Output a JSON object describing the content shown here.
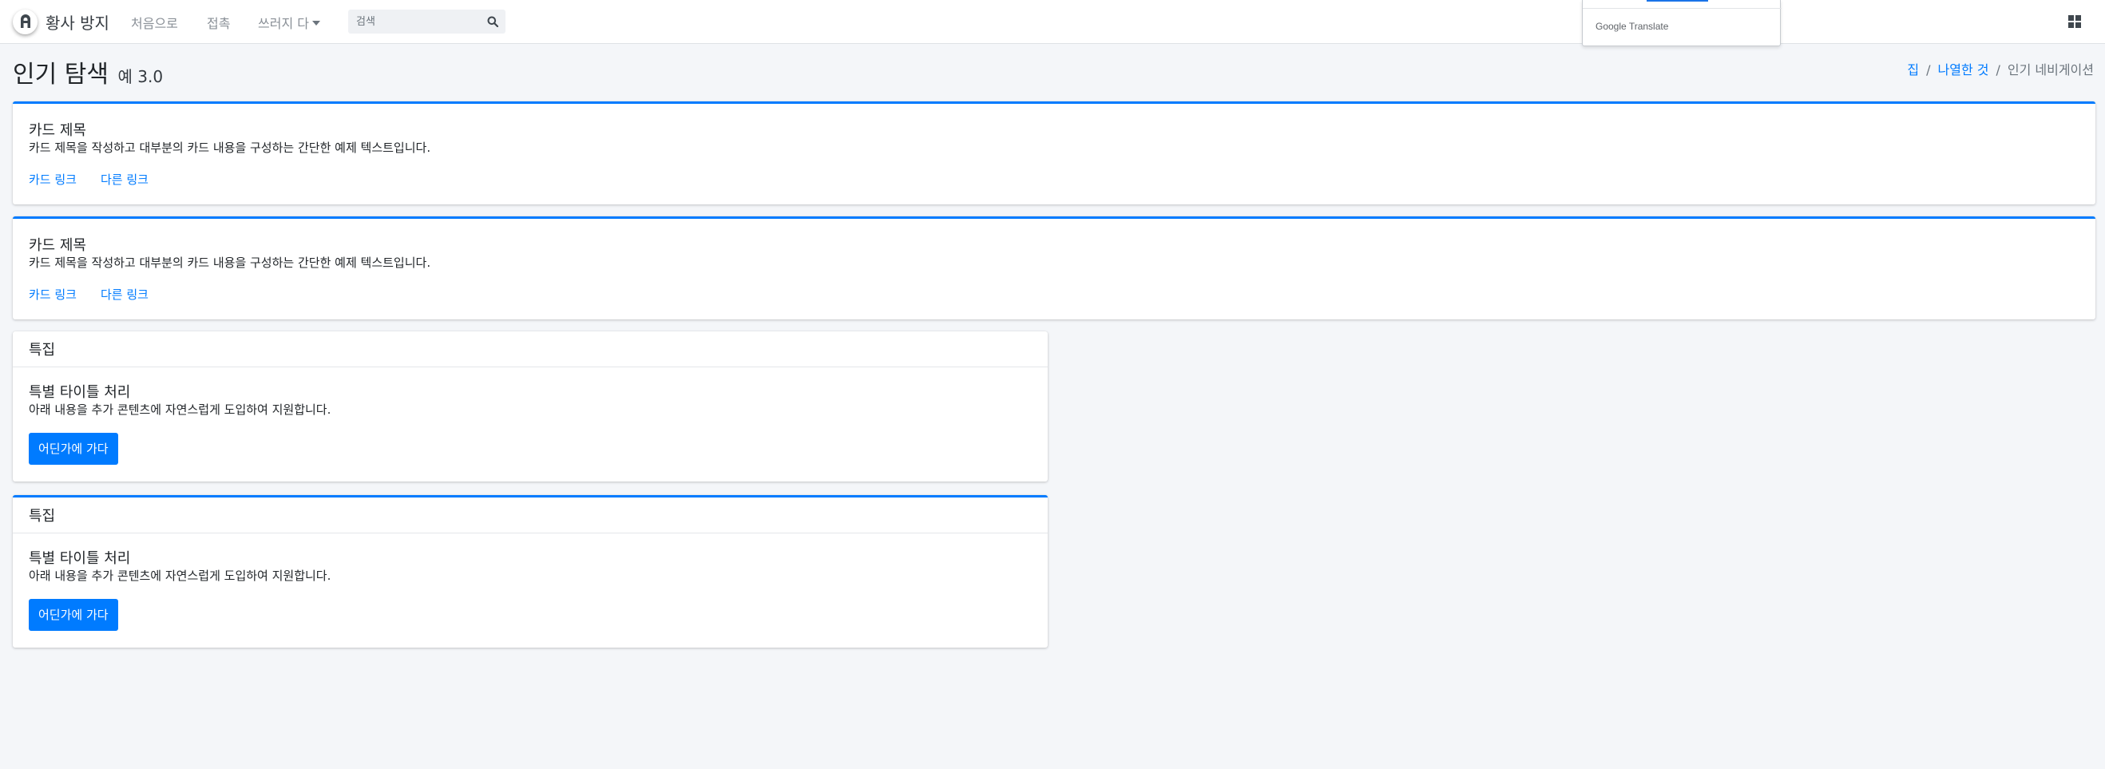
{
  "navbar": {
    "brand_name": "황사 방지",
    "links": [
      "처음으로",
      "접촉",
      "쓰러지 다"
    ],
    "search_placeholder": "검색"
  },
  "translate_widget": {
    "brand_google": "Google",
    "brand_translate": "Translate"
  },
  "header": {
    "title": "인기 탐색",
    "version": "예 3.0"
  },
  "breadcrumb": {
    "items": [
      "집",
      "나열한 것"
    ],
    "active": "인기 네비게이션"
  },
  "cards": [
    {
      "title": "카드 제목",
      "text": "카드 제목을 작성하고 대부분의 카드 내용을 구성하는 간단한 예제 텍스트입니다.",
      "link1": "카드 링크",
      "link2": "다른 링크"
    },
    {
      "title": "카드 제목",
      "text": "카드 제목을 작성하고 대부분의 카드 내용을 구성하는 간단한 예제 텍스트입니다.",
      "link1": "카드 링크",
      "link2": "다른 링크"
    }
  ],
  "featured_cards": [
    {
      "header": "특집",
      "title": "특별 타이틀 처리",
      "text": "아래 내용을 추가 콘텐츠에 자연스럽게 도입하여 지원합니다.",
      "button": "어딘가에 가다"
    },
    {
      "header": "특집",
      "title": "특별 타이틀 처리",
      "text": "아래 내용을 추가 콘텐츠에 자연스럽게 도입하여 지원합니다.",
      "button": "어딘가에 가다"
    }
  ],
  "colors": {
    "primary": "#007bff",
    "background": "#f4f6f9",
    "navbar": "#ffffff"
  },
  "icons": {
    "logo": "brand-logo-icon",
    "search": "search-icon",
    "apps": "apps-grid-icon"
  }
}
